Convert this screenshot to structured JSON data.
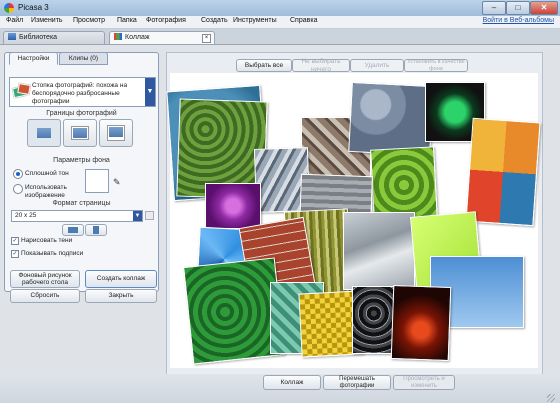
{
  "window": {
    "title": "Picasa 3"
  },
  "menu": {
    "items": [
      "Файл",
      "Изменить",
      "Просмотр",
      "Папка",
      "Фотография",
      "Создать",
      "Инструменты",
      "Справка"
    ],
    "signin": "Войти в Веб-альбомы"
  },
  "tabs": {
    "library": "Библиотека",
    "collage": "Коллаж"
  },
  "panel": {
    "tab_settings": "Настройки",
    "tab_clips": "Клипы (0)",
    "collage_type": "Стопка фотографий: похожа на беспорядочно разбросанные фотографии",
    "borders_label": "Границы фотографий",
    "background_label": "Параметры фона",
    "solid_color_label": "Сплошной тон",
    "use_image_label": "Использовать изображение",
    "page_format_label": "Формат страницы",
    "page_format_value": "20 x 25",
    "draw_shadows_label": "Нарисовать тени",
    "show_captions_label": "Показывать подписи"
  },
  "left_buttons": {
    "desktop_bg": "Фоновый рисунок рабочего стола",
    "create_collage": "Создать коллаж",
    "reset": "Сбросить",
    "close": "Закрыть"
  },
  "canvas_toolbar": {
    "select_all": "Выбрать все",
    "select_none": "Не выбирать ничего",
    "delete": "Удалить",
    "set_background": "Установить в качестве фона"
  },
  "bottom": {
    "collage": "Коллаж",
    "shuffle": "Перемешать фотографии",
    "view_edit": "Просмотреть и изменить"
  }
}
